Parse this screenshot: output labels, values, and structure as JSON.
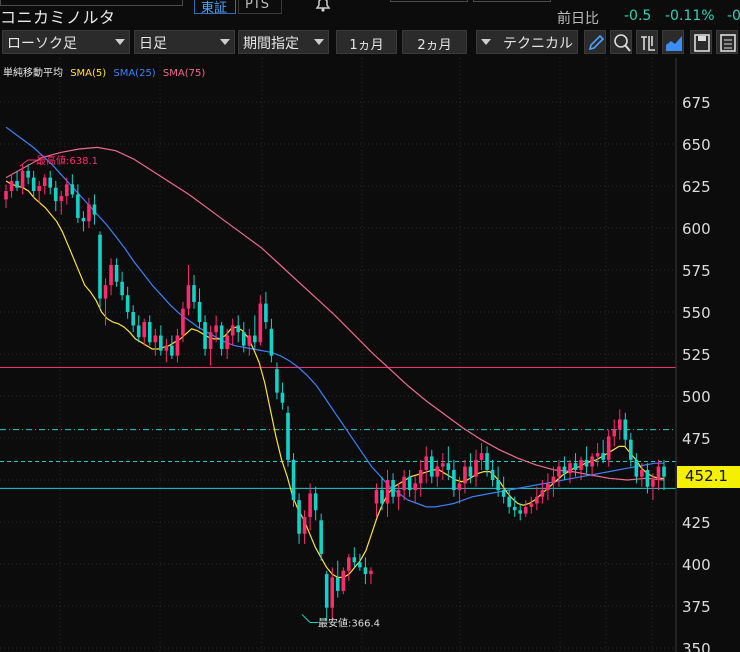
{
  "header": {
    "title": "コニカミノルタ",
    "exchange_tabs": [
      "東証",
      "PTS"
    ],
    "change_label": "前日比",
    "change_value": "-0.5",
    "change_pct": "-0.11%",
    "change_cut": "-0"
  },
  "toolbar": {
    "chart_type": "ローソク足",
    "period_unit": "日足",
    "range_mode": "期間指定",
    "range_1m": "1ヵ月",
    "range_2m": "2ヵ月",
    "technical": "テクニカル",
    "icons": [
      "pencil-icon",
      "zoom-icon",
      "output-icon",
      "area-chart-icon",
      "save-icon",
      "list-icon"
    ]
  },
  "legend": {
    "title": "単純移動平均",
    "sma5": "SMA(5)",
    "sma25": "SMA(25)",
    "sma75": "SMA(75)"
  },
  "colors": {
    "background": "#0c0c0c",
    "up_candle": "#ff2b6e",
    "down_candle": "#14d1c8",
    "sma5": "#ffe135",
    "sma25": "#3b82f6",
    "sma75": "#f06a8e",
    "price_tag": "#f5ef00"
  },
  "chart_data": {
    "type": "candlestick",
    "y_ticks": [
      675,
      650,
      625,
      600,
      575,
      550,
      525,
      500,
      475,
      450,
      425,
      400,
      375,
      350
    ],
    "current_price": "452.1",
    "high_label": "最高値:638.1",
    "low_label": "最安値:366.4",
    "horizontal_lines": [
      {
        "value": 517,
        "style": "solid",
        "color": "#ff2b6e"
      },
      {
        "value": 480,
        "style": "dashdot",
        "color": "#14d1c8"
      },
      {
        "value": 461,
        "style": "dashed",
        "color": "#14d1c8"
      },
      {
        "value": 445,
        "style": "solid",
        "color": "#14d1c8"
      }
    ],
    "candles": [
      [
        617,
        626,
        612,
        622
      ],
      [
        622,
        632,
        618,
        628
      ],
      [
        628,
        634,
        622,
        624
      ],
      [
        624,
        638,
        620,
        634
      ],
      [
        634,
        638,
        626,
        630
      ],
      [
        630,
        634,
        618,
        622
      ],
      [
        622,
        628,
        615,
        625
      ],
      [
        625,
        632,
        620,
        630
      ],
      [
        630,
        634,
        620,
        624
      ],
      [
        624,
        628,
        610,
        616
      ],
      [
        616,
        622,
        608,
        619
      ],
      [
        619,
        630,
        614,
        626
      ],
      [
        626,
        632,
        618,
        620
      ],
      [
        620,
        626,
        603,
        606
      ],
      [
        606,
        610,
        598,
        604
      ],
      [
        604,
        618,
        600,
        614
      ],
      [
        614,
        620,
        602,
        608
      ],
      [
        596,
        598,
        552,
        558
      ],
      [
        558,
        570,
        542,
        566
      ],
      [
        566,
        582,
        560,
        578
      ],
      [
        578,
        582,
        565,
        568
      ],
      [
        568,
        574,
        557,
        560
      ],
      [
        560,
        565,
        546,
        550
      ],
      [
        550,
        554,
        538,
        542
      ],
      [
        542,
        548,
        532,
        535
      ],
      [
        535,
        546,
        530,
        544
      ],
      [
        544,
        548,
        530,
        532
      ],
      [
        532,
        540,
        524,
        536
      ],
      [
        536,
        542,
        524,
        527
      ],
      [
        527,
        534,
        520,
        530
      ],
      [
        530,
        536,
        522,
        524
      ],
      [
        524,
        540,
        520,
        536
      ],
      [
        536,
        556,
        532,
        552
      ],
      [
        552,
        578,
        548,
        566
      ],
      [
        566,
        572,
        552,
        556
      ],
      [
        556,
        564,
        540,
        544
      ],
      [
        544,
        548,
        524,
        528
      ],
      [
        528,
        542,
        518,
        538
      ],
      [
        538,
        548,
        532,
        542
      ],
      [
        542,
        544,
        524,
        528
      ],
      [
        528,
        540,
        522,
        536
      ],
      [
        536,
        546,
        530,
        542
      ],
      [
        542,
        548,
        532,
        538
      ],
      [
        538,
        544,
        526,
        530
      ],
      [
        530,
        540,
        524,
        536
      ],
      [
        536,
        548,
        528,
        532
      ],
      [
        532,
        560,
        530,
        555
      ],
      [
        555,
        562,
        540,
        544
      ],
      [
        540,
        546,
        520,
        524
      ],
      [
        516,
        520,
        498,
        502
      ],
      [
        502,
        508,
        492,
        496
      ],
      [
        490,
        494,
        458,
        462
      ],
      [
        462,
        466,
        434,
        438
      ],
      [
        438,
        442,
        412,
        418
      ],
      [
        418,
        432,
        412,
        428
      ],
      [
        428,
        448,
        420,
        442
      ],
      [
        442,
        446,
        426,
        432
      ],
      [
        426,
        430,
        402,
        406
      ],
      [
        394,
        396,
        366,
        374
      ],
      [
        374,
        398,
        366,
        392
      ],
      [
        392,
        402,
        380,
        384
      ],
      [
        384,
        398,
        382,
        396
      ],
      [
        396,
        406,
        390,
        404
      ],
      [
        404,
        410,
        398,
        401
      ],
      [
        401,
        406,
        396,
        398
      ],
      [
        398,
        404,
        388,
        394
      ],
      [
        394,
        398,
        388,
        396
      ],
      [
        436,
        448,
        428,
        444
      ],
      [
        444,
        452,
        432,
        436
      ],
      [
        436,
        456,
        428,
        450
      ],
      [
        450,
        454,
        436,
        440
      ],
      [
        440,
        448,
        432,
        444
      ],
      [
        444,
        456,
        438,
        452
      ],
      [
        452,
        456,
        440,
        444
      ],
      [
        444,
        452,
        436,
        448
      ],
      [
        448,
        462,
        440,
        456
      ],
      [
        456,
        470,
        448,
        464
      ],
      [
        464,
        468,
        448,
        452
      ],
      [
        452,
        462,
        446,
        458
      ],
      [
        458,
        466,
        450,
        460
      ],
      [
        460,
        470,
        450,
        456
      ],
      [
        456,
        462,
        440,
        444
      ],
      [
        444,
        452,
        436,
        448
      ],
      [
        448,
        462,
        442,
        458
      ],
      [
        458,
        466,
        448,
        452
      ],
      [
        452,
        468,
        446,
        462
      ],
      [
        462,
        472,
        456,
        466
      ],
      [
        466,
        470,
        452,
        456
      ],
      [
        456,
        462,
        446,
        450
      ],
      [
        450,
        458,
        440,
        444
      ],
      [
        444,
        452,
        436,
        440
      ],
      [
        440,
        444,
        430,
        434
      ],
      [
        434,
        440,
        428,
        432
      ],
      [
        432,
        436,
        426,
        430
      ],
      [
        430,
        438,
        428,
        434
      ],
      [
        434,
        440,
        430,
        436
      ],
      [
        436,
        446,
        432,
        440
      ],
      [
        440,
        450,
        436,
        444
      ],
      [
        444,
        454,
        438,
        448
      ],
      [
        448,
        458,
        440,
        452
      ],
      [
        452,
        462,
        446,
        458
      ],
      [
        458,
        464,
        450,
        454
      ],
      [
        454,
        462,
        448,
        460
      ],
      [
        460,
        466,
        452,
        456
      ],
      [
        456,
        464,
        450,
        462
      ],
      [
        462,
        470,
        454,
        458
      ],
      [
        458,
        466,
        452,
        464
      ],
      [
        464,
        472,
        458,
        466
      ],
      [
        466,
        474,
        460,
        462
      ],
      [
        462,
        480,
        458,
        476
      ],
      [
        476,
        486,
        470,
        480
      ],
      [
        480,
        492,
        474,
        486
      ],
      [
        486,
        490,
        470,
        474
      ],
      [
        474,
        478,
        458,
        462
      ],
      [
        462,
        466,
        448,
        452
      ],
      [
        452,
        460,
        446,
        456
      ],
      [
        456,
        460,
        442,
        446
      ],
      [
        446,
        454,
        438,
        450
      ],
      [
        450,
        462,
        444,
        458
      ],
      [
        458,
        462,
        444,
        452
      ]
    ],
    "sma5": [
      628,
      626,
      625,
      624,
      622,
      618,
      615,
      612,
      608,
      604,
      598,
      590,
      582,
      574,
      566,
      562,
      557,
      550,
      546,
      544,
      543,
      541,
      538,
      534,
      532,
      530,
      528,
      528,
      529,
      530,
      532,
      534,
      537,
      540,
      539,
      537,
      535,
      534,
      534,
      536,
      540,
      541,
      539,
      535,
      528,
      520,
      508,
      492,
      476,
      462,
      452,
      440,
      432,
      426,
      418,
      410,
      404,
      398,
      394,
      392,
      392,
      394,
      398,
      402,
      408,
      418,
      428,
      436,
      442,
      446,
      448,
      450,
      452,
      453,
      454,
      455,
      456,
      456,
      454,
      452,
      450,
      449,
      450,
      452,
      454,
      455,
      455,
      452,
      448,
      443,
      439,
      436,
      435,
      436,
      438,
      441,
      444,
      447,
      450,
      453,
      455,
      457,
      458,
      460,
      461,
      462,
      464,
      466,
      468,
      470,
      470,
      466,
      462,
      457,
      454,
      452,
      451,
      451
    ],
    "sma25": [
      660,
      656,
      652,
      648,
      643,
      638,
      632,
      626,
      620,
      614,
      608,
      602,
      595,
      588,
      580,
      573,
      566,
      560,
      554,
      549,
      545,
      541,
      538,
      535,
      532,
      530,
      529,
      528,
      527,
      526,
      524,
      521,
      517,
      512,
      506,
      498,
      490,
      482,
      474,
      466,
      458,
      452,
      446,
      442,
      438,
      436,
      434,
      434,
      435,
      436,
      438,
      440,
      441,
      442,
      443,
      444,
      445,
      446,
      447,
      448,
      449,
      450,
      451,
      452,
      453,
      454,
      455,
      456,
      457,
      458,
      459,
      460,
      460
    ],
    "sma75": [
      630,
      636,
      642,
      645,
      647,
      648,
      646,
      641,
      634,
      627,
      620,
      612,
      604,
      596,
      588,
      578,
      568,
      558,
      548,
      537,
      526,
      516,
      506,
      497,
      489,
      481,
      474,
      468,
      463,
      459,
      456,
      455,
      453,
      451,
      450,
      451,
      450
    ]
  }
}
